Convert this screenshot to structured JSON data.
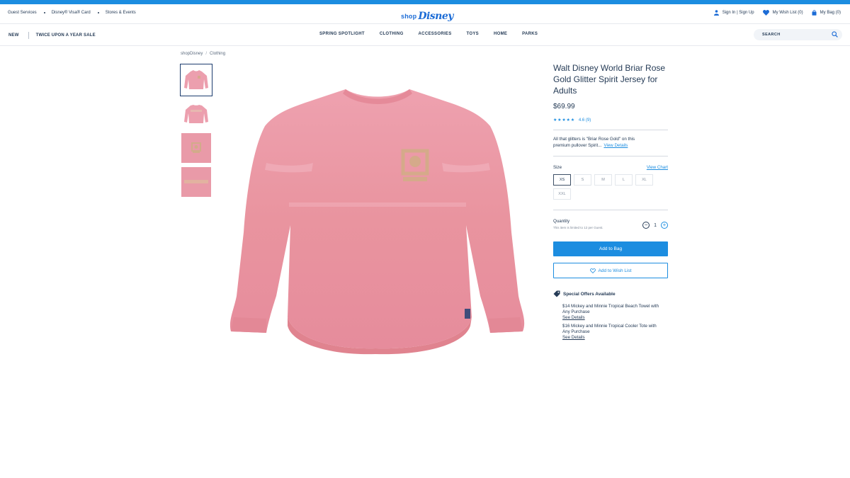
{
  "utility": {
    "left_links": [
      "Guest Services",
      "Disney® Visa® Card",
      "Stores & Events"
    ],
    "logo_shop": "shop",
    "logo_brand": "Disney",
    "sign_in": "Sign In | Sign Up",
    "wishlist": "My Wish List (0)",
    "bag": "My Bag (0)"
  },
  "nav": {
    "new": "NEW",
    "sale": "TWICE UPON A YEAR SALE",
    "items": [
      "SPRING SPOTLIGHT",
      "CLOTHING",
      "ACCESSORIES",
      "TOYS",
      "HOME",
      "PARKS"
    ],
    "search_placeholder": "SEARCH"
  },
  "breadcrumb": [
    "shopDisney",
    "Clothing"
  ],
  "product": {
    "title": "Walt Disney World Briar Rose Gold Glitter Spirit Jersey for Adults",
    "price": "$69.99",
    "stars": "★★★★★",
    "rating": "4.6 (9)",
    "description": "All that glitters is \"Briar Rose Gold\" on this premium pullover Spirit...",
    "view_details": "View Details",
    "size_label": "Size",
    "view_chart": "View Chart",
    "sizes": [
      "XS",
      "S",
      "M",
      "L",
      "XL",
      "XXL"
    ],
    "selected_size": "XS",
    "quantity_label": "Quantity",
    "quantity_note": "This item is limited to 12 per Guest.",
    "quantity": "1",
    "minus": "−",
    "plus": "+",
    "add_to_bag": "Add to Bag",
    "add_to_wishlist": "Add to Wish List",
    "offers_title": "Special Offers Available",
    "offers": [
      {
        "text": "$14 Mickey and Minnie Tropical Beach Towel with Any Purchase",
        "link": "See Details"
      },
      {
        "text": "$16 Mickey and Minnie Tropical Cooler Tote with Any Purchase",
        "link": "See Details"
      }
    ]
  },
  "colors": {
    "accent": "#1c8de0",
    "text": "#253b56",
    "jersey": "#e99aa8"
  }
}
